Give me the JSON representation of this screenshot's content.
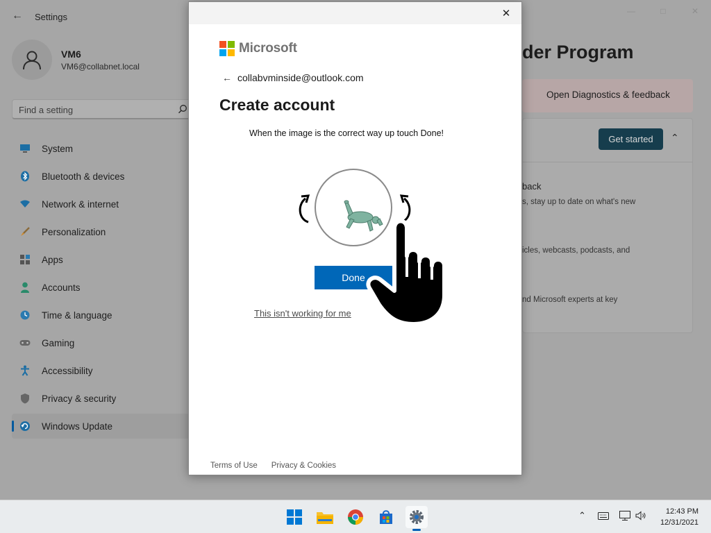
{
  "settings": {
    "app_title": "Settings",
    "profile": {
      "name": "VM6",
      "email": "VM6@collabnet.local"
    },
    "search": {
      "placeholder": "Find a setting"
    },
    "nav": [
      {
        "label": "System",
        "icon": "monitor-icon",
        "selected": false
      },
      {
        "label": "Bluetooth & devices",
        "icon": "bluetooth-icon",
        "selected": false
      },
      {
        "label": "Network & internet",
        "icon": "wifi-icon",
        "selected": false
      },
      {
        "label": "Personalization",
        "icon": "brush-icon",
        "selected": false
      },
      {
        "label": "Apps",
        "icon": "apps-icon",
        "selected": false
      },
      {
        "label": "Accounts",
        "icon": "person-icon",
        "selected": false
      },
      {
        "label": "Time & language",
        "icon": "clock-globe-icon",
        "selected": false
      },
      {
        "label": "Gaming",
        "icon": "gamepad-icon",
        "selected": false
      },
      {
        "label": "Accessibility",
        "icon": "accessibility-icon",
        "selected": false
      },
      {
        "label": "Privacy & security",
        "icon": "shield-icon",
        "selected": false
      },
      {
        "label": "Windows Update",
        "icon": "update-icon",
        "selected": true
      }
    ],
    "main": {
      "title_fragment": "der Program",
      "diagnostics_link": "Open Diagnostics & feedback",
      "get_started_label": "Get started",
      "fragments": [
        "back",
        "s, stay up to date on what's new",
        "icles, webcasts, podcasts, and",
        "nd Microsoft experts at key"
      ]
    }
  },
  "dialog": {
    "brand": "Microsoft",
    "identity": "collabvminside@outlook.com",
    "title": "Create account",
    "instruction": "When the image is the correct way up touch Done!",
    "done_label": "Done",
    "not_working_link": "This isn't working for me",
    "footer": {
      "terms": "Terms of Use",
      "privacy": "Privacy & Cookies"
    }
  },
  "taskbar": {
    "apps": [
      {
        "name": "start-button",
        "icon": "windows-logo-icon"
      },
      {
        "name": "file-explorer",
        "icon": "folder-icon"
      },
      {
        "name": "chrome",
        "icon": "chrome-icon"
      },
      {
        "name": "microsoft-store",
        "icon": "store-icon"
      },
      {
        "name": "settings-app",
        "icon": "gear-icon",
        "active": true
      }
    ],
    "time": "12:43 PM",
    "date": "12/31/2021"
  },
  "colors": {
    "accent_blue": "#0067b8",
    "get_started_bg": "#163d4d",
    "ms_red": "#f25022",
    "ms_green": "#7fba00",
    "ms_blue": "#00a4ef",
    "ms_yellow": "#ffb900"
  }
}
